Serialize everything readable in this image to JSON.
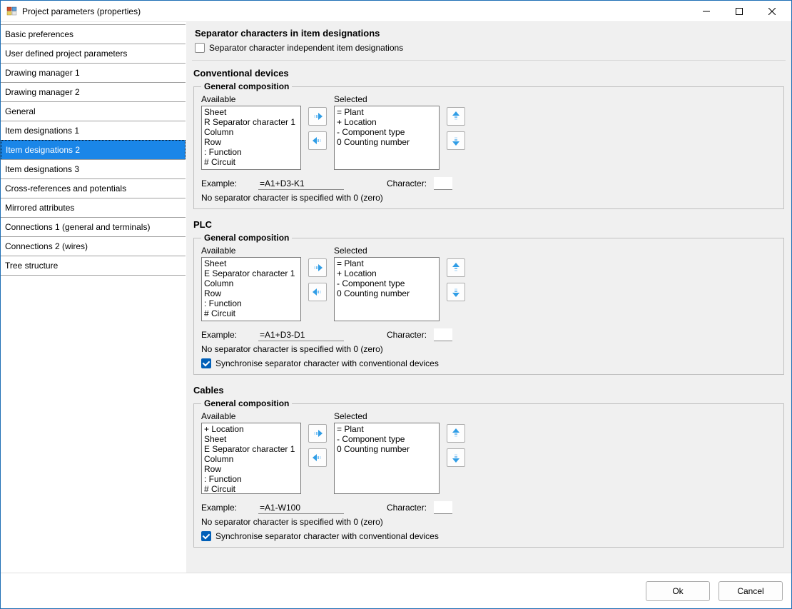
{
  "window": {
    "title": "Project parameters (properties)"
  },
  "sidebar": {
    "items": [
      {
        "label": "Basic preferences"
      },
      {
        "label": "User defined project parameters"
      },
      {
        "label": "Drawing manager 1"
      },
      {
        "label": "Drawing manager 2"
      },
      {
        "label": "General"
      },
      {
        "label": "Item designations 1"
      },
      {
        "label": "Item designations 2",
        "selected": true
      },
      {
        "label": "Item designations 3"
      },
      {
        "label": "Cross-references and potentials"
      },
      {
        "label": "Mirrored attributes"
      },
      {
        "label": "Connections 1 (general and terminals)"
      },
      {
        "label": "Connections 2 (wires)"
      },
      {
        "label": "Tree structure"
      }
    ]
  },
  "separator_section": {
    "title": "Separator characters in item designations",
    "checkbox_label": "Separator character independent item designations",
    "checked": false
  },
  "conventional": {
    "title": "Conventional devices",
    "group_title": "General composition",
    "available_label": "Available",
    "selected_label": "Selected",
    "available": [
      "Sheet",
      "R Separator character 1",
      "Column",
      "Row",
      ": Function",
      "# Circuit"
    ],
    "selected": [
      "= Plant",
      "+ Location",
      "- Component type",
      "0 Counting number"
    ],
    "example_label": "Example:",
    "example_value": "=A1+D3-K1",
    "character_label": "Character:",
    "character_value": "",
    "note": "No separator character is specified with 0 (zero)"
  },
  "plc": {
    "title": "PLC",
    "group_title": "General composition",
    "available_label": "Available",
    "selected_label": "Selected",
    "available": [
      "Sheet",
      "E Separator character 1",
      "Column",
      "Row",
      ": Function",
      "# Circuit"
    ],
    "selected": [
      "= Plant",
      "+ Location",
      "- Component type",
      "0 Counting number"
    ],
    "example_label": "Example:",
    "example_value": "=A1+D3-D1",
    "character_label": "Character:",
    "character_value": "",
    "note": "No separator character is specified with 0 (zero)",
    "sync_label": "Synchronise separator character with conventional devices",
    "sync_checked": true
  },
  "cables": {
    "title": "Cables",
    "group_title": "General composition",
    "available_label": "Available",
    "selected_label": "Selected",
    "available": [
      "+ Location",
      "Sheet",
      "E Separator character 1",
      "Column",
      "Row",
      ": Function",
      "# Circuit"
    ],
    "selected": [
      "= Plant",
      "- Component type",
      "0 Counting number"
    ],
    "example_label": "Example:",
    "example_value": "=A1-W100",
    "character_label": "Character:",
    "character_value": "",
    "note": "No separator character is specified with 0 (zero)",
    "sync_label": "Synchronise separator character with conventional devices",
    "sync_checked": true
  },
  "footer": {
    "ok": "Ok",
    "cancel": "Cancel"
  }
}
